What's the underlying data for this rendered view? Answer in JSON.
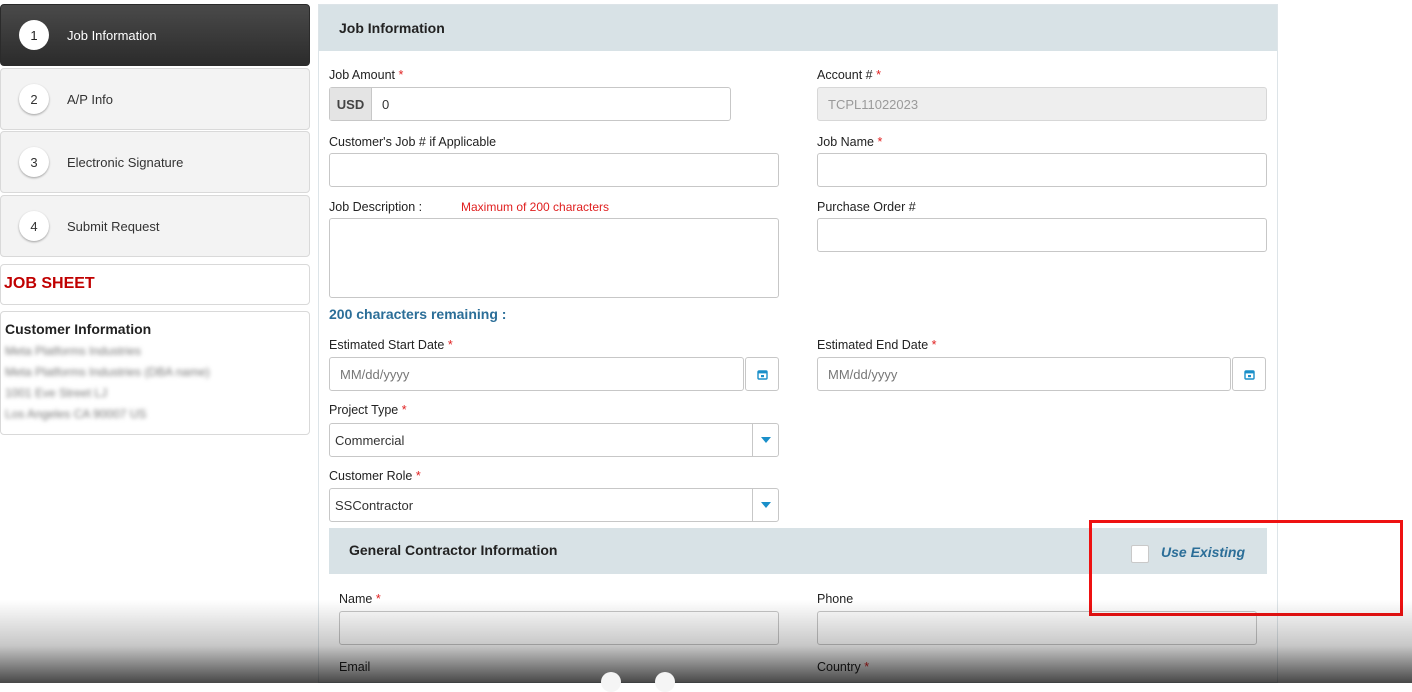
{
  "steps": [
    {
      "num": "1",
      "label": "Job Information",
      "active": true
    },
    {
      "num": "2",
      "label": "A/P Info",
      "active": false
    },
    {
      "num": "3",
      "label": "Electronic Signature",
      "active": false
    },
    {
      "num": "4",
      "label": "Submit Request",
      "active": false
    }
  ],
  "job_sheet": "JOB SHEET",
  "customer_info": {
    "title": "Customer Information",
    "lines": [
      "Meta Platforms Industries",
      "Meta Platforms Industries (DBA name)",
      "1001 Eve Street LJ",
      "Los Angeles CA 90007 US"
    ]
  },
  "panel": {
    "title": "Job Information",
    "job_amount": {
      "label": "Job Amount",
      "currency": "USD",
      "value": "0"
    },
    "account": {
      "label": "Account #",
      "value": "TCPL11022023"
    },
    "customer_job": {
      "label": "Customer's Job # if Applicable",
      "value": ""
    },
    "job_name": {
      "label": "Job Name",
      "value": ""
    },
    "job_description": {
      "label": "Job Description :",
      "hint": "Maximum of 200 characters",
      "value": ""
    },
    "purchase_order": {
      "label": "Purchase Order #",
      "value": ""
    },
    "remaining": "200 characters remaining :",
    "start_date": {
      "label": "Estimated Start Date",
      "placeholder": "MM/dd/yyyy"
    },
    "end_date": {
      "label": "Estimated End Date",
      "placeholder": "MM/dd/yyyy"
    },
    "project_type": {
      "label": "Project Type",
      "value": "Commercial"
    },
    "customer_role": {
      "label": "Customer Role",
      "value": "SSContractor"
    },
    "required_mark": "*"
  },
  "gc": {
    "title": "General Contractor Information",
    "use_existing": "Use Existing",
    "name_label": "Name",
    "phone_label": "Phone",
    "email_label": "Email",
    "country_label": "Country"
  },
  "colors": {
    "accent_blue": "#2b6e98",
    "required_red": "#e02020",
    "header_bg": "#d8e2e6",
    "highlight_box": "#e11111"
  }
}
